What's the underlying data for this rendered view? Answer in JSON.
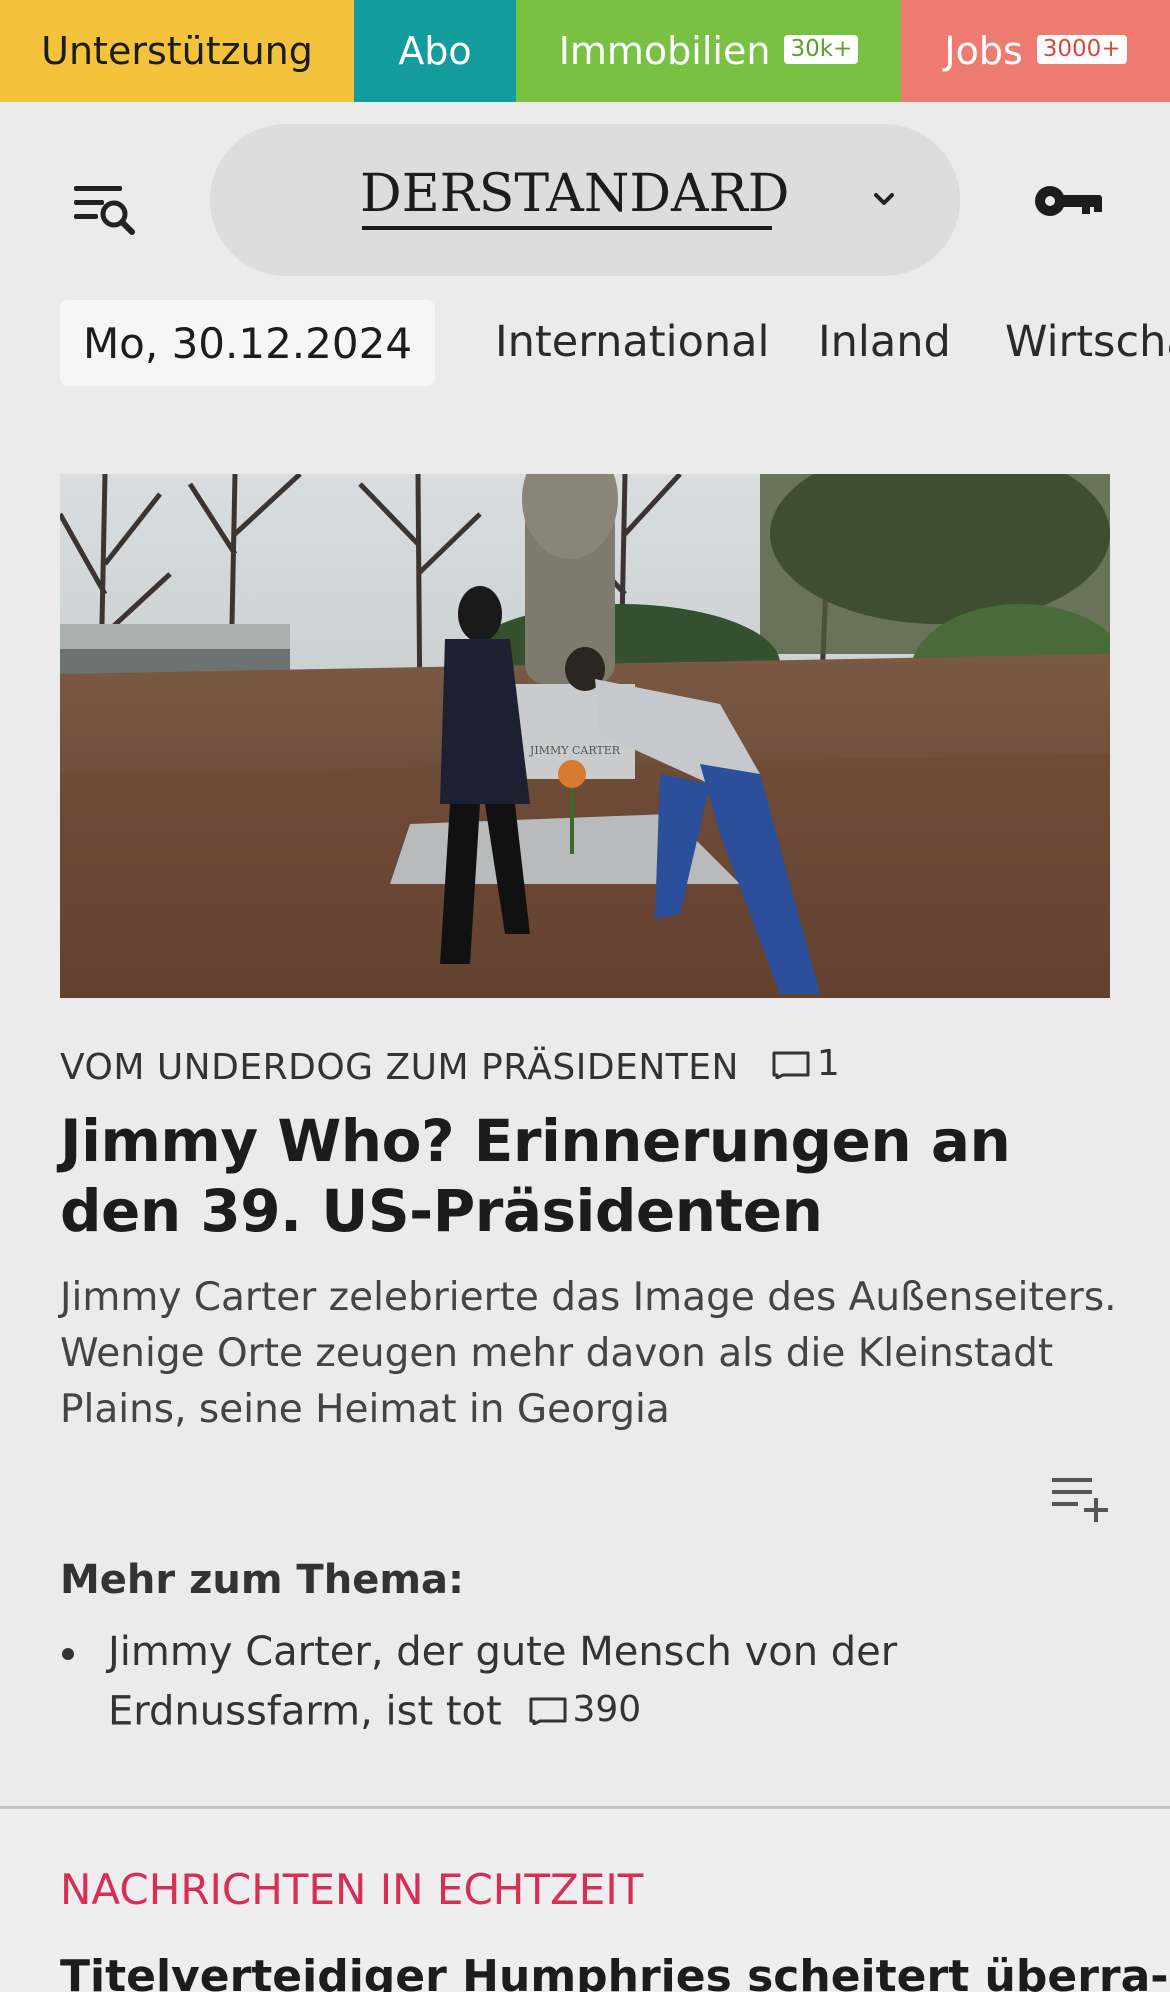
{
  "topnav": {
    "support": "Unterstützung",
    "abo": "Abo",
    "immobilien": "Immobilien",
    "immobilien_badge": "30k+",
    "jobs": "Jobs",
    "jobs_badge": "3000+"
  },
  "header": {
    "logo": "DERSTANDARD",
    "icons": {
      "menu": "menu-search-icon",
      "edition": "chevron-down-icon",
      "login": "key-icon"
    }
  },
  "nav": {
    "date": "Mo, 30.12.2024",
    "items": [
      "International",
      "Inland",
      "Wirtscha"
    ]
  },
  "article": {
    "kicker": "VOM UNDERDOG ZUM PRÄSIDENTEN",
    "comments": "1",
    "headline": "Jimmy Who? Erinnerungen an den 39. US-Präsidenten",
    "teaser": "Jimmy Carter zelebrierte das Image des Außenseiters. Wenige Orte zeugen mehr davon als die Kleinstadt Plains, seine Heimat in Georgia",
    "image_text": "JIMMY CARTER",
    "more_title": "Mehr zum Thema:",
    "related": [
      {
        "title": "Jimmy Carter, der gute Mensch von der Erdnussfarm, ist tot",
        "comments": "390"
      }
    ]
  },
  "live": {
    "title": "NACHRICHTEN IN ECHTZEIT",
    "headline": "Titelverteidiger Humphries scheitert überra-"
  },
  "colors": {
    "support": "#f5c33b",
    "abo": "#139c9c",
    "immobilien": "#79c143",
    "jobs": "#ee7b72",
    "live_accent": "#d72e55"
  }
}
